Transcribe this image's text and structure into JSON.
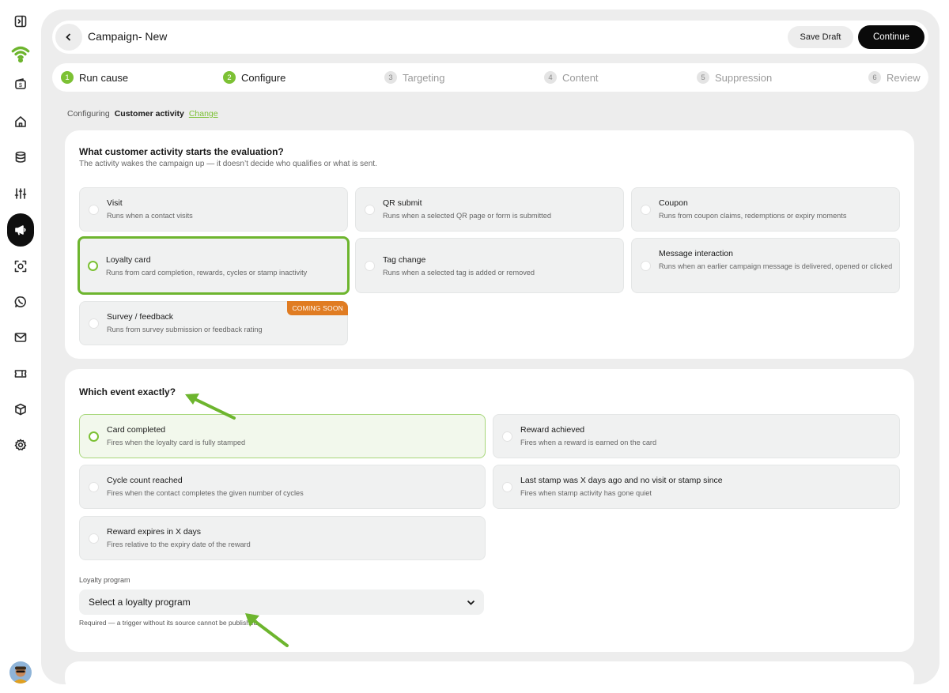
{
  "header": {
    "title": "Campaign- New",
    "save_draft": "Save Draft",
    "continue": "Continue"
  },
  "steps": [
    {
      "num": "1",
      "label": "Run cause",
      "state": "done"
    },
    {
      "num": "2",
      "label": "Configure",
      "state": "done"
    },
    {
      "num": "3",
      "label": "Targeting",
      "state": "todo"
    },
    {
      "num": "4",
      "label": "Content",
      "state": "todo"
    },
    {
      "num": "5",
      "label": "Suppression",
      "state": "todo"
    },
    {
      "num": "6",
      "label": "Review",
      "state": "todo"
    }
  ],
  "crumb": {
    "prefix": "Configuring",
    "value": "Customer activity",
    "action": "Change"
  },
  "activity": {
    "title": "What customer activity starts the evaluation?",
    "subtitle": "The activity wakes the campaign up — it doesn’t decide who qualifies or what is sent.",
    "options": [
      {
        "title": "Visit",
        "desc": "Runs when a contact visits",
        "selected": false
      },
      {
        "title": "QR submit",
        "desc": "Runs when a selected QR page or form is submitted",
        "selected": false
      },
      {
        "title": "Coupon",
        "desc": "Runs from coupon claims, redemptions or expiry moments",
        "selected": false
      },
      {
        "title": "Loyalty card",
        "desc": "Runs from card completion, rewards, cycles or stamp inactivity",
        "selected": true
      },
      {
        "title": "Tag change",
        "desc": "Runs when a selected tag is added or removed",
        "selected": false
      },
      {
        "title": "Message interaction",
        "desc": "Runs when an earlier campaign message is delivered, opened or clicked",
        "selected": false
      },
      {
        "title": "Survey / feedback",
        "desc": "Runs from survey submission or feedback rating",
        "selected": false,
        "badge": "COMING SOON"
      }
    ]
  },
  "event": {
    "title": "Which event exactly?",
    "options": [
      {
        "title": "Card completed",
        "desc": "Fires when the loyalty card is fully stamped",
        "selected": true
      },
      {
        "title": "Reward achieved",
        "desc": "Fires when a reward is earned on the card",
        "selected": false
      },
      {
        "title": "Cycle count reached",
        "desc": "Fires when the contact completes the given number of cycles",
        "selected": false
      },
      {
        "title": "Last stamp was X days ago and no visit or stamp since",
        "desc": "Fires when stamp activity has gone quiet",
        "selected": false
      },
      {
        "title": "Reward expires in X days",
        "desc": "Fires relative to the expiry date of the reward",
        "selected": false
      }
    ],
    "program_label": "Loyalty program",
    "program_value": "Select a loyalty program",
    "program_helper": "Required — a trigger without its source cannot be published"
  },
  "colors": {
    "accent": "#7cc134",
    "badge": "#e07c22",
    "primary_button": "#0a0a0a",
    "annotation_arrow": "#6db52e"
  },
  "icons": [
    "sidebar-toggle-icon",
    "wifi-logo-icon",
    "wallet-icon",
    "home-icon",
    "database-icon",
    "sliders-icon",
    "megaphone-icon",
    "scan-icon",
    "whatsapp-icon",
    "mail-icon",
    "ticket-icon",
    "box-icon",
    "gear-icon",
    "chevron-left-icon",
    "chevron-down-icon"
  ]
}
